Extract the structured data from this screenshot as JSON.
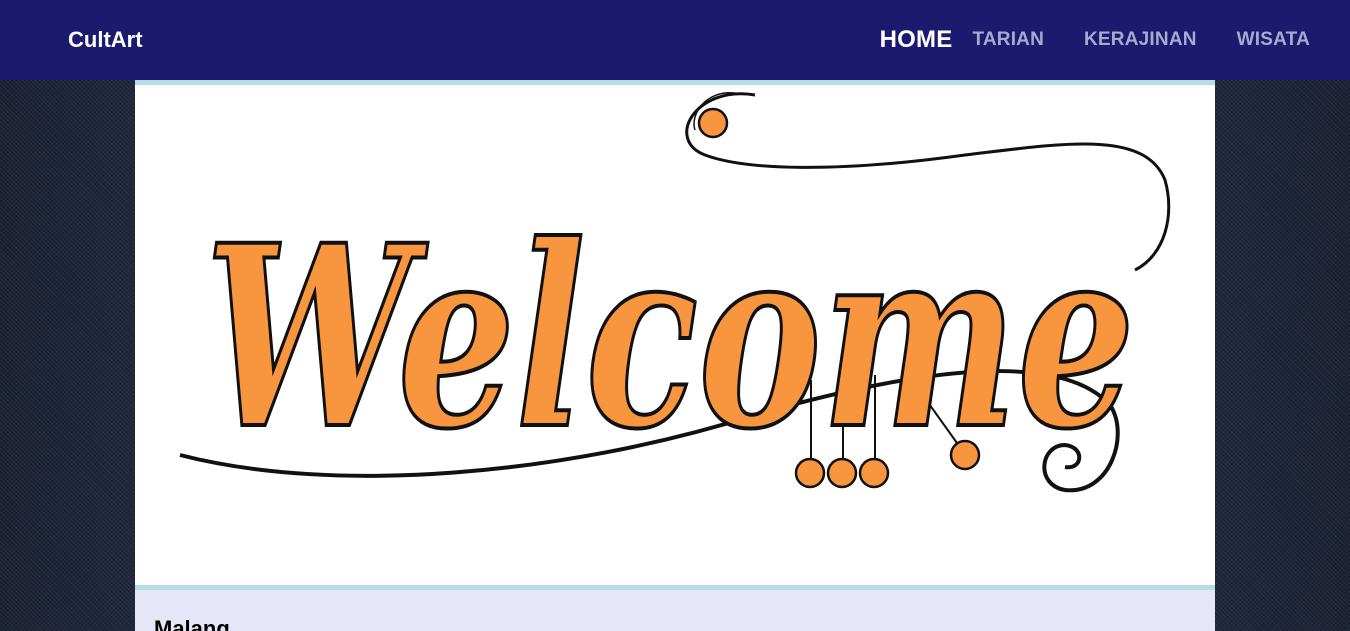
{
  "navbar": {
    "brand": "CultArt",
    "items": [
      {
        "label": "HOME",
        "active": true
      },
      {
        "label": "TARIAN",
        "active": false
      },
      {
        "label": "KERAJINAN",
        "active": false
      },
      {
        "label": "WISATA",
        "active": false
      }
    ]
  },
  "hero": {
    "image_text": "Welcome",
    "accent_color": "#f7963f"
  },
  "section": {
    "title": "Malang"
  },
  "colors": {
    "navbar_bg": "#1b1a6f",
    "content_bg": "#e6e6f8",
    "hero_border": "#b6dce6"
  }
}
